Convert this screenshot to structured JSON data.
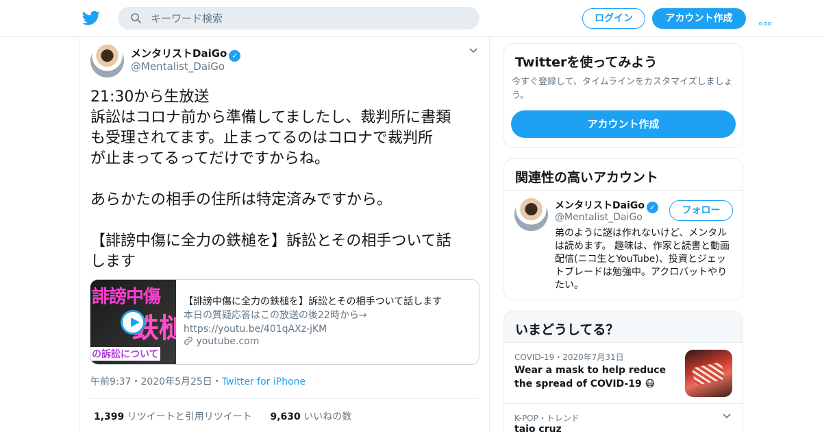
{
  "header": {
    "search_placeholder": "キーワード検索",
    "login_label": "ログイン",
    "signup_label": "アカウント作成"
  },
  "tweet": {
    "author_name": "メンタリストDaiGo",
    "author_handle": "@Mentalist_DaiGo",
    "lines": [
      "21:30から生放送",
      "訴訟はコロナ前から準備してましたし、裁判所に書類",
      "も受理されてます。止まってるのはコロナで裁判所",
      "が止まってるってだけですからね。",
      "",
      "あらかたの相手の住所は特定済みですから。",
      "",
      "【誹謗中傷に全力の鉄槌を】訴訟とその相手ついて話",
      "します"
    ],
    "card": {
      "thumb_text_1": "誹謗中傷",
      "thumb_text_2": "鉄槌",
      "thumb_text_3": "の訴訟について",
      "title": "【誹謗中傷に全力の鉄槌を】訴訟とその相手ついて話します",
      "desc_line1": "本日の質疑応答はこの放送の後22時から→",
      "desc_line2": "https://youtu.be/401qAXz-jKM",
      "domain": "youtube.com"
    },
    "time": "午前9:37",
    "date": "2020年5月25日",
    "source": "Twitter for iPhone",
    "retweets_count": "1,399",
    "retweets_label": "リツイートと引用リツイート",
    "likes_count": "9,630",
    "likes_label": "いいねの数"
  },
  "signup_panel": {
    "title": "Twitterを使ってみよう",
    "subtitle": "今すぐ登録して、タイムラインをカスタマイズしましょう。",
    "button_label": "アカウント作成"
  },
  "related_panel": {
    "title": "関連性の高いアカウント",
    "account_name": "メンタリストDaiGo",
    "account_handle": "@Mentalist_DaiGo",
    "follow_label": "フォロー",
    "bio": "弟のように謎は作れないけど、メンタルは読めます。 趣味は、作家と読書と動画配信(ニコ生とYouTube)、投資とジェットブレードは勉強中。アクロバットやりたい。"
  },
  "trends_panel": {
    "title": "いまどうしてる？",
    "item1_category": "COVID-19",
    "item1_date": "2020年7月31日",
    "item1_headline": "Wear a mask to help reduce the spread of COVID-19 😷",
    "item2_meta": "K-POP・トレンド",
    "item2_headline": "taio cruz"
  },
  "colors": {
    "accent": "#1da1f2",
    "text": "#14171a",
    "muted": "#657786",
    "border": "#e6ecf0"
  }
}
